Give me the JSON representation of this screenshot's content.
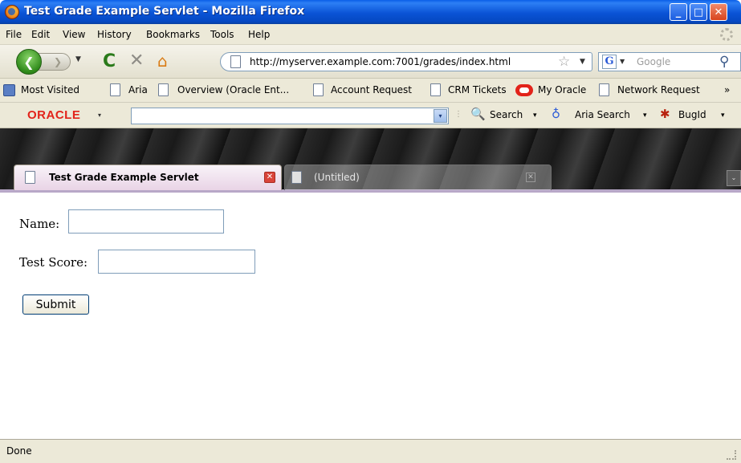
{
  "window": {
    "title": "Test Grade Example Servlet - Mozilla Firefox",
    "min_glyph": "_",
    "max_glyph": "□",
    "close_glyph": "✕"
  },
  "menu": {
    "items": [
      "File",
      "Edit",
      "View",
      "History",
      "Bookmarks",
      "Tools",
      "Help"
    ]
  },
  "nav": {
    "url": "http://myserver.example.com:7001/grades/index.html",
    "search_placeholder": "Google",
    "back_glyph": "❮",
    "forward_glyph": "❯",
    "reload_glyph": "C",
    "stop_glyph": "✕",
    "home_glyph": "⌂",
    "star_glyph": "☆",
    "search_engine_glyph": "G",
    "magnifier_glyph": "⚲",
    "dropdown_glyph": "▼"
  },
  "bookmarks": {
    "items": [
      "Most Visited",
      "Aria",
      "Overview (Oracle Ent...",
      "Account Request",
      "CRM Tickets",
      "My Oracle",
      "Network Request"
    ],
    "overflow_glyph": "»"
  },
  "oracle_toolbar": {
    "logo": "ORACLE",
    "search_label": "Search",
    "aria_search_label": "Aria Search",
    "bugid_label": "BugId",
    "search_glyph": "🔍",
    "aria_glyph": "♁",
    "bug_glyph": "✱",
    "grip_glyph": "⋮",
    "dropdown_glyph": "▾"
  },
  "tabs": [
    {
      "title": "Test Grade Example Servlet",
      "active": true,
      "close_glyph": "✕"
    },
    {
      "title": "(Untitled)",
      "active": false,
      "close_glyph": "✕"
    }
  ],
  "tab_list_glyph": "⌄",
  "form": {
    "name_label": "Name:",
    "name_value": "",
    "score_label": "Test Score:",
    "score_value": "",
    "submit_label": "Submit"
  },
  "status": {
    "text": "Done"
  },
  "colors": {
    "titlebar_blue": "#0a53d6",
    "oracle_red": "#e2231a",
    "chrome_bg": "#ece9d8",
    "back_green": "#2f8a1a"
  }
}
